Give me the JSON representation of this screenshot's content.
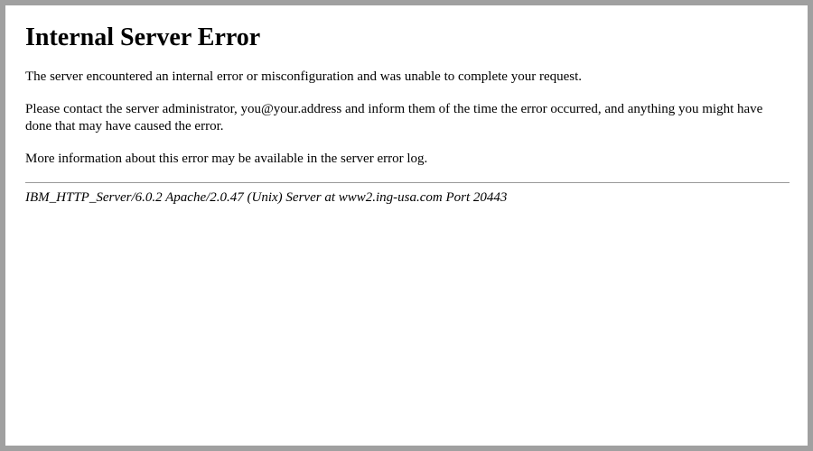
{
  "error": {
    "title": "Internal Server Error",
    "paragraph1": "The server encountered an internal error or misconfiguration and was unable to complete your request.",
    "paragraph2": "Please contact the server administrator, you@your.address and inform them of the time the error occurred, and anything you might have done that may have caused the error.",
    "paragraph3": "More information about this error may be available in the server error log.",
    "signature": "IBM_HTTP_Server/6.0.2 Apache/2.0.47 (Unix) Server at www2.ing-usa.com Port 20443"
  }
}
